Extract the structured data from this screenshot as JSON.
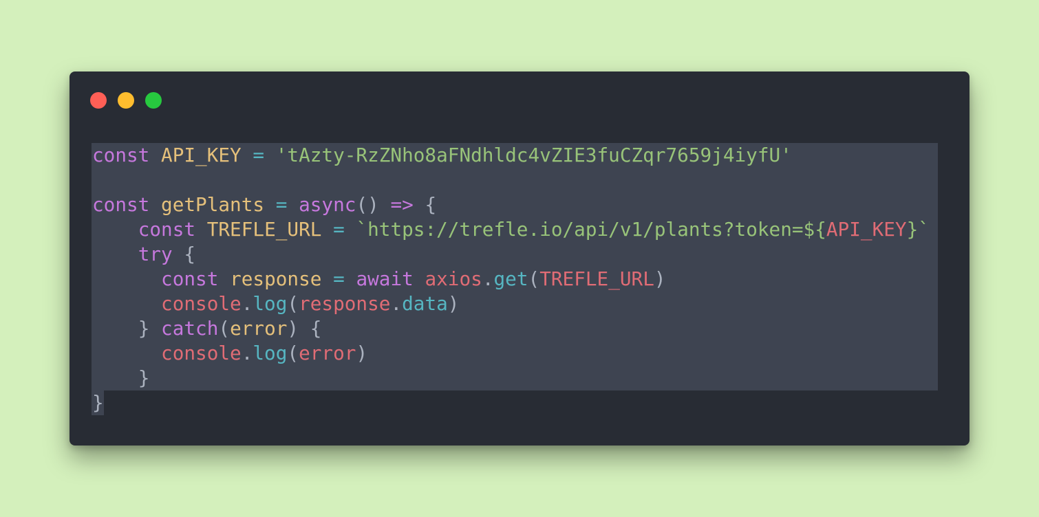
{
  "window": {
    "controls": [
      "close",
      "minimize",
      "maximize"
    ]
  },
  "colors": {
    "background": "#d4f0bc",
    "window": "#282c34",
    "selection": "#3e4451",
    "keyword": "#c678dd",
    "variable": "#e5c07b",
    "operator": "#56b6c2",
    "string": "#98c379",
    "object": "#e06c75",
    "punctuation": "#abb2bf"
  },
  "code": {
    "line1": {
      "kw": "const",
      "name": "API_KEY",
      "op": "=",
      "value": "'tAzty-RzZNho8aFNdhldc4vZIE3fuCZqr7659j4iyfU'"
    },
    "line3": {
      "kw": "const",
      "name": "getPlants",
      "op": "=",
      "async": "async",
      "parens": "()",
      "arrow": "=>",
      "brace": "{"
    },
    "line4": {
      "kw": "const",
      "name": "TREFLE_URL",
      "op": "=",
      "str_start": "`https://trefle.io/api/v1/plants?token=${",
      "interp": "API_KEY",
      "str_end": "}`"
    },
    "line5": {
      "kw": "try",
      "brace": "{"
    },
    "line6": {
      "kw": "const",
      "name": "response",
      "op": "=",
      "await": "await",
      "obj": "axios",
      "dot": ".",
      "method": "get",
      "open": "(",
      "arg": "TREFLE_URL",
      "close": ")"
    },
    "line7": {
      "obj": "console",
      "dot": ".",
      "method": "log",
      "open": "(",
      "arg": "response",
      "dot2": ".",
      "prop": "data",
      "close": ")"
    },
    "line8": {
      "brace_close": "}",
      "kw": "catch",
      "open": "(",
      "arg": "error",
      "close": ")",
      "brace": "{"
    },
    "line9": {
      "obj": "console",
      "dot": ".",
      "method": "log",
      "open": "(",
      "arg": "error",
      "close": ")"
    },
    "line10": {
      "brace": "}"
    },
    "line11": {
      "brace": "}"
    }
  }
}
